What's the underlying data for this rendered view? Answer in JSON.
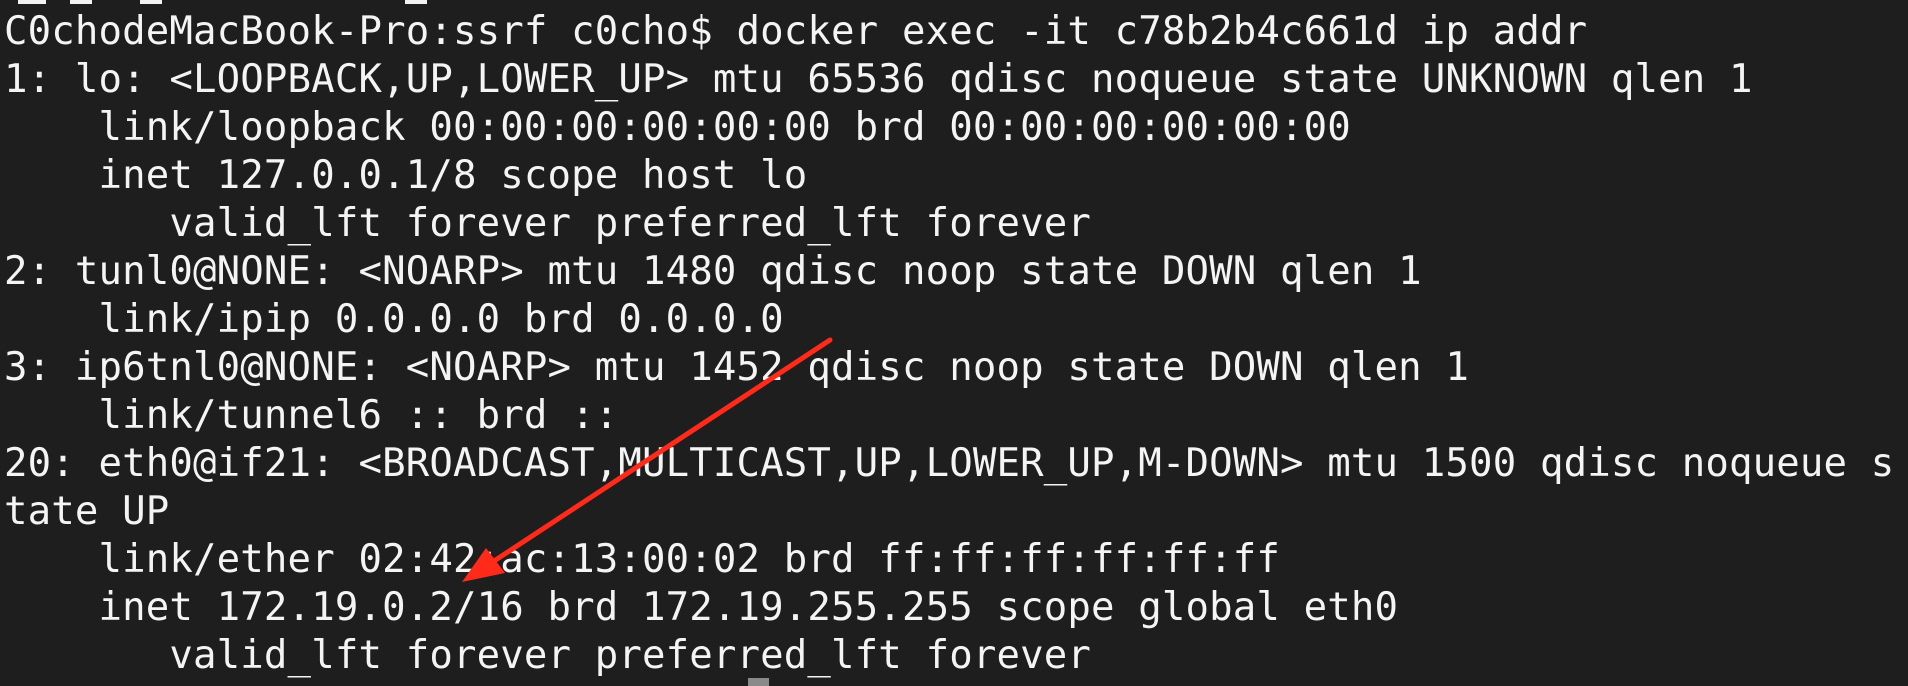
{
  "terminal": {
    "lines": [
      "C0chodeMacBook-Pro:ssrf c0cho$ docker exec -it c78b2b4c661d ip addr",
      "1: lo: <LOOPBACK,UP,LOWER_UP> mtu 65536 qdisc noqueue state UNKNOWN qlen 1",
      "    link/loopback 00:00:00:00:00:00 brd 00:00:00:00:00:00",
      "    inet 127.0.0.1/8 scope host lo",
      "       valid_lft forever preferred_lft forever",
      "2: tunl0@NONE: <NOARP> mtu 1480 qdisc noop state DOWN qlen 1",
      "    link/ipip 0.0.0.0 brd 0.0.0.0",
      "3: ip6tnl0@NONE: <NOARP> mtu 1452 qdisc noop state DOWN qlen 1",
      "    link/tunnel6 :: brd ::",
      "20: eth0@if21: <BROADCAST,MULTICAST,UP,LOWER_UP,M-DOWN> mtu 1500 qdisc noqueue s",
      "tate UP",
      "    link/ether 02:42:ac:13:00:02 brd ff:ff:ff:ff:ff:ff",
      "    inet 172.19.0.2/16 brd 172.19.255.255 scope global eth0",
      "       valid_lft forever preferred_lft forever"
    ]
  },
  "colors": {
    "background": "#1e1e1e",
    "text": "#f4f4f4",
    "arrow": "#ff2a1a"
  },
  "annotation": {
    "icon": "red-arrow-icon"
  }
}
